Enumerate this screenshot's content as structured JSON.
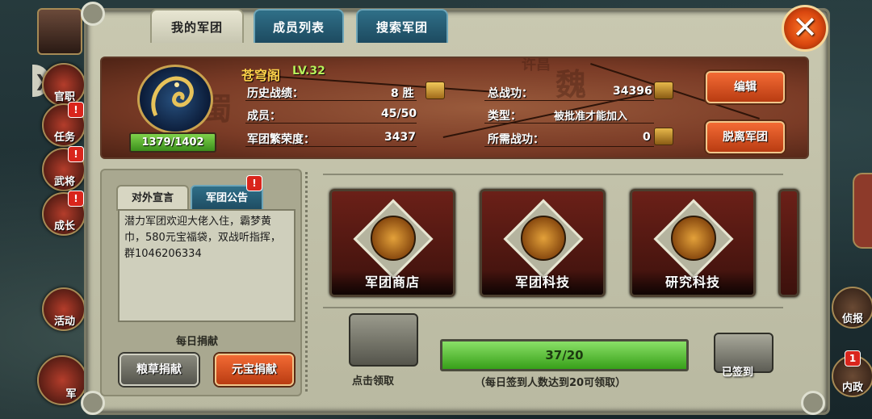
{
  "tabs": [
    {
      "label": "我的军团",
      "active": true
    },
    {
      "label": "成员列表",
      "active": false
    },
    {
      "label": "搜索军团",
      "active": false
    }
  ],
  "side_menu": [
    {
      "label": "官职",
      "badge": ""
    },
    {
      "label": "任务",
      "badge": "!"
    },
    {
      "label": "武将",
      "badge": "!"
    },
    {
      "label": "成长",
      "badge": "!"
    },
    {
      "label": "活动",
      "badge": ""
    },
    {
      "label": "军",
      "badge": ""
    }
  ],
  "right_menu": [
    {
      "label": "侦报",
      "badge": ""
    },
    {
      "label": "内政",
      "badge": "1"
    }
  ],
  "legion": {
    "name": "苍穹阁",
    "level": "LV.32",
    "exp": "1379/1402",
    "exp_fraction": 0.984,
    "history_label": "历史战绩：",
    "history_value": "8 胜",
    "members_label": "成员：",
    "members_value": "45/50",
    "prosperity_label": "军团繁荣度：",
    "prosperity_value": "3437",
    "total_merit_label": "总战功：",
    "total_merit_value": "34396",
    "type_label": "类型：",
    "type_value": "被批准才能加入",
    "needed_merit_label": "所需战功：",
    "needed_merit_value": "0",
    "edit_button": "编辑",
    "leave_button": "脱离军团"
  },
  "announcement": {
    "tab_public": "对外宣言",
    "tab_notice": "军团公告",
    "notice_badge": "!",
    "text": "潜力军团欢迎大佬入住，霸梦黄巾，580元宝福袋，双战听指挥，群1046206334"
  },
  "donate": {
    "title": "每日捐献",
    "grain_button": "粮草捐献",
    "ingot_button": "元宝捐献"
  },
  "features": [
    {
      "label": "军团商店",
      "icon": "money-bag-icon"
    },
    {
      "label": "军团科技",
      "icon": "scroll-icon"
    },
    {
      "label": "研究科技",
      "icon": "magnifier-scroll-icon"
    }
  ],
  "signin": {
    "chest_label": "点击领取",
    "progress_text": "37/20",
    "progress_fraction": 1.0,
    "hint": "（每日签到人数达到20可领取）",
    "signed_label": "已签到"
  },
  "map_chars": [
    "魏",
    "蜀",
    "许昌"
  ],
  "colors": {
    "accent_orange": "#d9470f",
    "progress_green": "#5bc23a",
    "gold_text": "#ffd24a"
  }
}
